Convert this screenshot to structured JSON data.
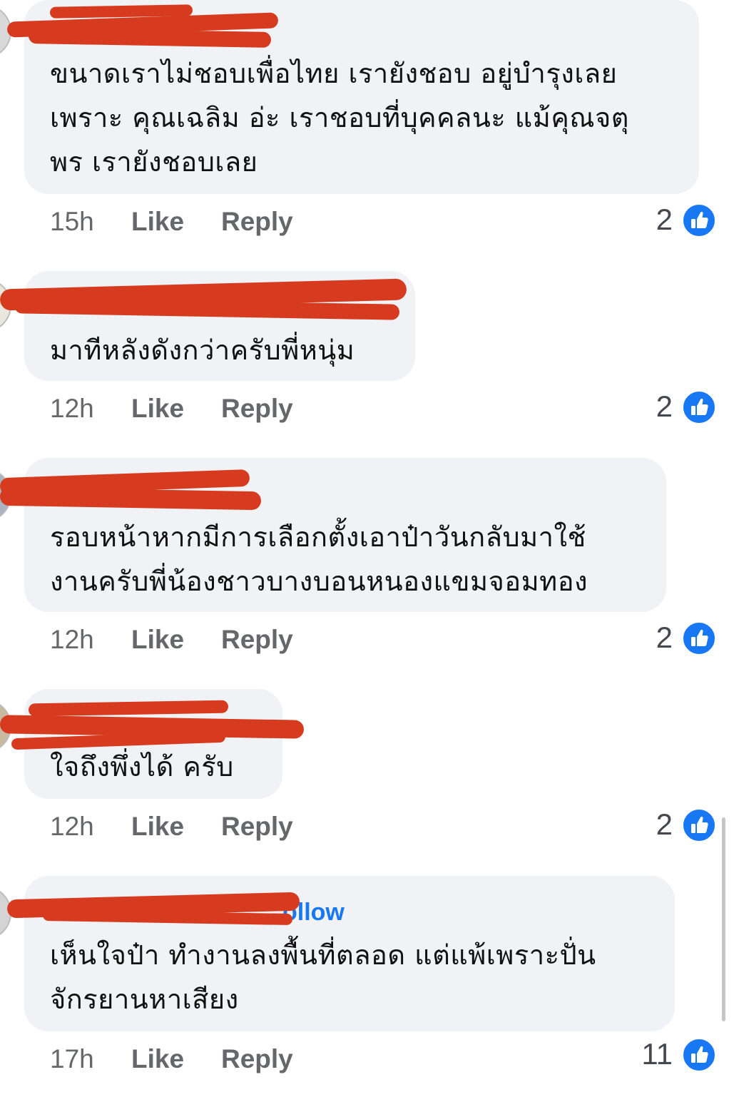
{
  "comments": [
    {
      "text": "ขนาดเราไม่ชอบเพื่อไทย เรายังชอบ อยู่บำรุงเลย\nเพราะ คุณเฉลิม อ่ะ เราชอบที่บุคคลนะ แม้คุณจตุ\nพร เรายังชอบเลย",
      "time": "15h",
      "like_label": "Like",
      "reply_label": "Reply",
      "reaction_count": "2",
      "reaction_icon": "thumbs-up-icon"
    },
    {
      "text": "มาทีหลังดังกว่าครับพี่หนุ่ม",
      "time": "12h",
      "like_label": "Like",
      "reply_label": "Reply",
      "reaction_count": "2",
      "reaction_icon": "thumbs-up-icon"
    },
    {
      "text": "รอบหน้าหากมีการเลือกตั้งเอาป๋าวันกลับมาใช้\nงานครับพี่น้องชาวบางบอนหนองแขมจอมทอง",
      "time": "12h",
      "like_label": "Like",
      "reply_label": "Reply",
      "reaction_count": "2",
      "reaction_icon": "thumbs-up-icon"
    },
    {
      "text": "ใจถึงพึ่งได้ ครับ",
      "time": "12h",
      "like_label": "Like",
      "reply_label": "Reply",
      "reaction_count": "2",
      "reaction_icon": "thumbs-up-icon"
    },
    {
      "text": "เห็นใจป๋า ทำงานลงพื้นที่ตลอด แต่แพ้เพราะปั่น\nจักรยานหาเสียง",
      "follow_label": "ollow",
      "time": "17h",
      "like_label": "Like",
      "reply_label": "Reply",
      "reaction_count": "11",
      "reaction_icon": "thumbs-up-icon"
    }
  ],
  "colors": {
    "bubble": "#f0f2f5",
    "redaction": "#d63b1f",
    "like_blue": "#1877f2",
    "meta_text": "#65676b"
  }
}
